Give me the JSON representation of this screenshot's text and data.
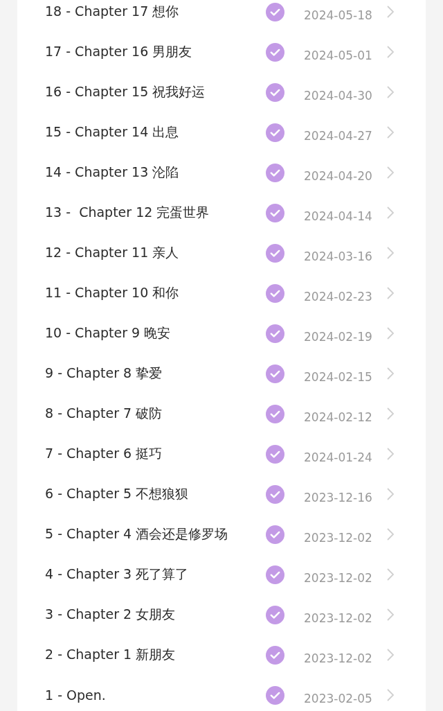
{
  "chapters": [
    {
      "title": "18 - Chapter 17 想你",
      "checked": true,
      "date": "2024-05-18"
    },
    {
      "title": "17 - Chapter 16 男朋友",
      "checked": true,
      "date": "2024-05-01"
    },
    {
      "title": "16 - Chapter 15 祝我好运",
      "checked": true,
      "date": "2024-04-30"
    },
    {
      "title": "15 - Chapter 14 出息",
      "checked": true,
      "date": "2024-04-27"
    },
    {
      "title": "14 - Chapter 13 沦陷",
      "checked": true,
      "date": "2024-04-20"
    },
    {
      "title": "13 -  Chapter 12 完蛋世界",
      "checked": true,
      "date": "2024-04-14"
    },
    {
      "title": "12 - Chapter 11 亲人",
      "checked": true,
      "date": "2024-03-16"
    },
    {
      "title": "11 - Chapter 10 和你",
      "checked": true,
      "date": "2024-02-23"
    },
    {
      "title": "10 - Chapter 9 晚安",
      "checked": true,
      "date": "2024-02-19"
    },
    {
      "title": "9 - Chapter 8 挚爱",
      "checked": true,
      "date": "2024-02-15"
    },
    {
      "title": "8 - Chapter 7 破防",
      "checked": true,
      "date": "2024-02-12"
    },
    {
      "title": "7 - Chapter 6 挺巧",
      "checked": true,
      "date": "2024-01-24"
    },
    {
      "title": "6 - Chapter 5 不想狼狈",
      "checked": true,
      "date": "2023-12-16"
    },
    {
      "title": "5 - Chapter 4 酒会还是修罗场",
      "checked": true,
      "date": "2023-12-02"
    },
    {
      "title": "4 - Chapter 3 死了算了",
      "checked": true,
      "date": "2023-12-02"
    },
    {
      "title": "3 - Chapter 2 女朋友",
      "checked": true,
      "date": "2023-12-02"
    },
    {
      "title": "2 - Chapter 1 新朋友",
      "checked": true,
      "date": "2023-12-02"
    },
    {
      "title": "1 - Open.",
      "checked": true,
      "date": "2023-02-05"
    }
  ]
}
